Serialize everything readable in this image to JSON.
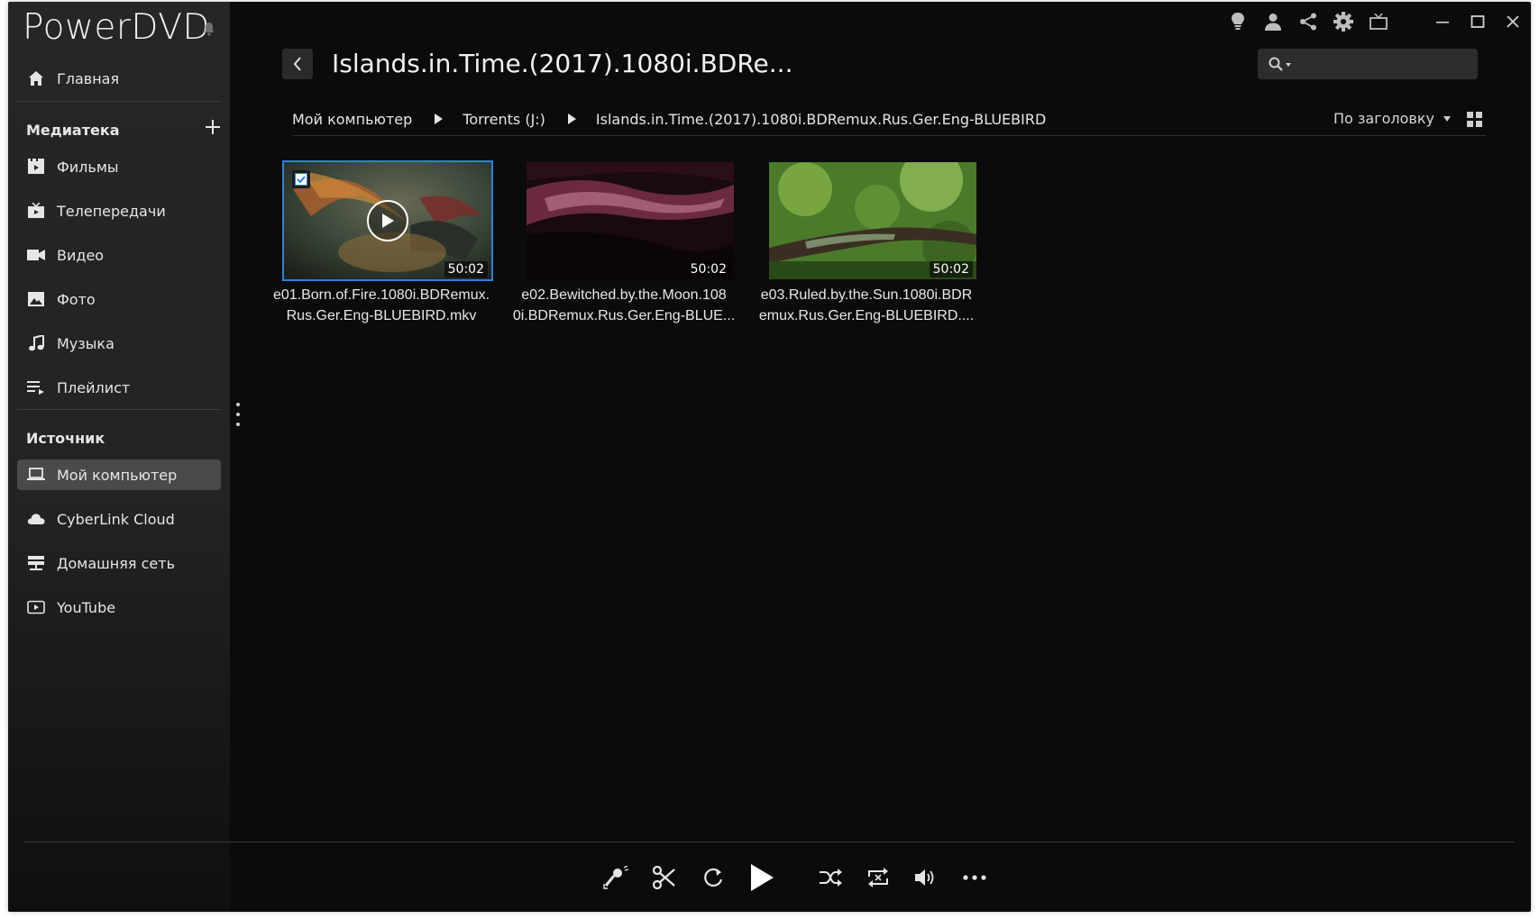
{
  "app": {
    "name": "PowerDVD"
  },
  "sidebar": {
    "home_label": "Главная",
    "library_title": "Медиатека",
    "library_items": [
      {
        "label": "Фильмы",
        "icon": "movies-icon"
      },
      {
        "label": "Телепередачи",
        "icon": "tv-shows-icon"
      },
      {
        "label": "Видео",
        "icon": "video-camera-icon"
      },
      {
        "label": "Фото",
        "icon": "photo-icon"
      },
      {
        "label": "Музыка",
        "icon": "music-note-icon"
      },
      {
        "label": "Плейлист",
        "icon": "playlist-icon"
      }
    ],
    "source_title": "Источник",
    "source_items": [
      {
        "label": "Мой компьютер",
        "icon": "laptop-icon",
        "active": true
      },
      {
        "label": "CyberLink Cloud",
        "icon": "cloud-icon"
      },
      {
        "label": "Домашняя сеть",
        "icon": "home-network-icon"
      },
      {
        "label": "YouTube",
        "icon": "youtube-icon"
      }
    ]
  },
  "header": {
    "title": "Islands.in.Time.(2017).1080i.BDRe...",
    "search_placeholder": "",
    "search_value": ""
  },
  "breadcrumb": [
    "Мой компьютер",
    "Torrents (J:)",
    "Islands.in.Time.(2017).1080i.BDRemux.Rus.Ger.Eng-BLUEBIRD"
  ],
  "sort": {
    "label": "По заголовку"
  },
  "files": [
    {
      "name": "e01.Born.of.Fire.1080i.BDRemux.\nRus.Ger.Eng-BLUEBIRD.mkv",
      "duration": "50:02",
      "selected": true
    },
    {
      "name": "e02.Bewitched.by.the.Moon.108\n0i.BDRemux.Rus.Ger.Eng-BLUE...",
      "duration": "50:02",
      "selected": false
    },
    {
      "name": "e03.Ruled.by.the.Sun.1080i.BDR\nemux.Rus.Ger.Eng-BLUEBIRD....",
      "duration": "50:02",
      "selected": false
    }
  ],
  "colors": {
    "accent": "#2f7fe0",
    "background": "#0b0b0b",
    "sidebar": "#262626",
    "active_item": "#4a4a4a"
  }
}
